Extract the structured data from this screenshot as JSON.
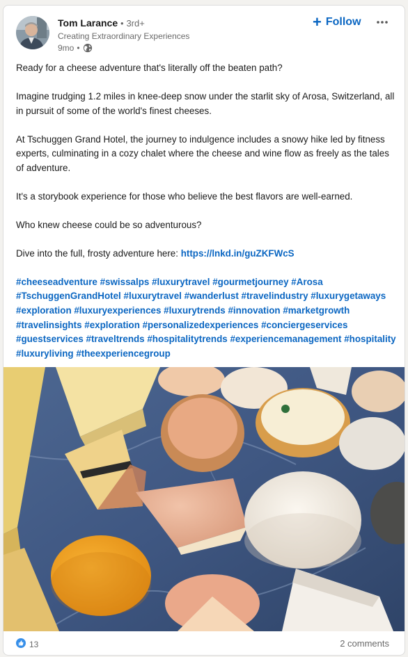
{
  "post": {
    "author": {
      "name": "Tom Larance",
      "separator": "•",
      "degree": "3rd+",
      "tagline": "Creating Extraordinary Experiences",
      "time": "9mo",
      "visibility_icon": "globe-icon"
    },
    "follow_label": "Follow",
    "more_icon": "more-icon",
    "paragraphs": [
      "Ready for a cheese adventure that's literally off the beaten path?",
      "Imagine trudging 1.2 miles in knee-deep snow under the starlit sky of Arosa, Switzerland, all in pursuit of some of the world's finest cheeses.",
      "At Tschuggen Grand Hotel, the journey to indulgence includes a snowy hike led by fitness experts, culminating in a cozy chalet where the cheese and wine flow as freely as the tales of adventure.",
      "It's a storybook experience for those who believe the best flavors are well-earned.",
      "Who knew cheese could be so adventurous?"
    ],
    "link_intro": "Dive into the full, frosty adventure here: ",
    "link_text": "https://lnkd.in/guZKFWcS",
    "hashtags": [
      "#cheeseadventure",
      "#swissalps",
      "#luxurytravel",
      "#gourmetjourney",
      "#Arosa",
      "#TschuggenGrandHotel",
      "#luxurytravel",
      "#wanderlust",
      "#travelindustry",
      "#luxurygetaways",
      "#exploration",
      "#luxuryexperiences",
      "#luxurytrends",
      "#innovation",
      "#marketgrowth",
      "#travelinsights",
      "#exploration",
      "#personalizedexperiences",
      "#conciergeservices",
      "#guestservices",
      "#traveltrends",
      "#hospitalitytrends",
      "#experiencemanagement",
      "#hospitality",
      "#luxuryliving",
      "#theexperiencegroup"
    ],
    "reaction_count": "13",
    "comments_label": "2 comments",
    "colors": {
      "link": "#0a66c2",
      "like_badge": "#378fe9"
    }
  }
}
